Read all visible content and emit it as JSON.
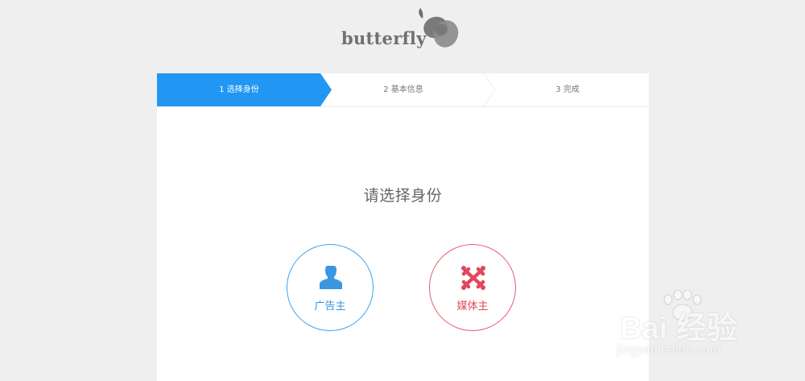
{
  "logo": {
    "text": "butterfly",
    "mark_icon": "butterfly-wings-icon"
  },
  "steps": [
    {
      "label": "1 选择身份",
      "state": "active"
    },
    {
      "label": "2 基本信息",
      "state": "inactive"
    },
    {
      "label": "3 完成",
      "state": "inactive"
    }
  ],
  "main": {
    "title": "请选择身份"
  },
  "roles": [
    {
      "label": "广告主",
      "icon": "user-silhouette-icon",
      "color": "#3ea2ea"
    },
    {
      "label": "媒体主",
      "icon": "joomla-icon",
      "color": "#ec5a6f"
    }
  ],
  "watermark": {
    "brand": "Bai 经验",
    "url": "jingyan.baidu.com"
  },
  "colors": {
    "accent": "#2196f3",
    "page_background": "#efefef",
    "card_background": "#ffffff"
  }
}
